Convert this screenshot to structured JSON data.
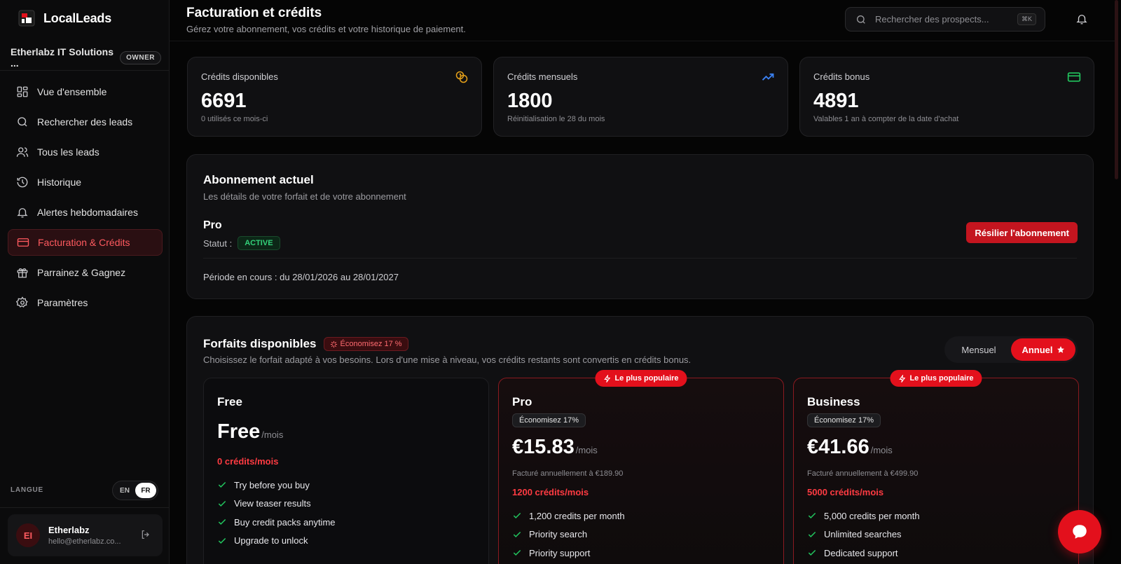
{
  "app": {
    "name": "LocalLeads"
  },
  "org": {
    "name": "Etherlabz IT Solutions ...",
    "role": "OWNER"
  },
  "sidebar": {
    "items": [
      {
        "label": "Vue d'ensemble",
        "icon": "grid-icon"
      },
      {
        "label": "Rechercher des leads",
        "icon": "search-icon"
      },
      {
        "label": "Tous les leads",
        "icon": "users-icon"
      },
      {
        "label": "Historique",
        "icon": "history-icon"
      },
      {
        "label": "Alertes hebdomadaires",
        "icon": "bell-icon"
      },
      {
        "label": "Facturation & Crédits",
        "icon": "credit-card-icon",
        "active": true
      },
      {
        "label": "Parrainez & Gagnez",
        "icon": "gift-icon"
      },
      {
        "label": "Paramètres",
        "icon": "gear-icon"
      }
    ],
    "langue_label": "LANGUE",
    "languages": [
      "EN",
      "FR"
    ],
    "selected_language": "FR"
  },
  "user": {
    "initials": "EI",
    "name": "Etherlabz",
    "email": "hello@etherlabz.co..."
  },
  "header": {
    "title": "Facturation et crédits",
    "subtitle": "Gérez votre abonnement, vos crédits et votre historique de paiement.",
    "search_placeholder": "Rechercher des prospects...",
    "shortcut": "⌘K"
  },
  "stats": [
    {
      "label": "Crédits disponibles",
      "value": "6691",
      "note": "0 utilisés ce mois-ci",
      "icon": "coins-icon",
      "color": "#e5a019"
    },
    {
      "label": "Crédits mensuels",
      "value": "1800",
      "note": "Réinitialisation le 28 du mois",
      "icon": "trending-up-icon",
      "color": "#3b82f6"
    },
    {
      "label": "Crédits bonus",
      "value": "4891",
      "note": "Valables 1 an à compter de la date d'achat",
      "icon": "card-icon",
      "color": "#22c55e"
    }
  ],
  "subscription": {
    "title": "Abonnement actuel",
    "description": "Les détails de votre forfait et de votre abonnement",
    "plan": "Pro",
    "status_label": "Statut :",
    "status": "ACTIVE",
    "cancel_label": "Résilier l'abonnement",
    "period": "Période en cours : du 28/01/2026 au 28/01/2027"
  },
  "plans": {
    "title": "Forfaits disponibles",
    "save_chip": "Économisez 17 %",
    "description": "Choisissez le forfait adapté à vos besoins. Lors d'une mise à niveau, vos crédits restants sont convertis en crédits bonus.",
    "billing_options": [
      "Mensuel",
      "Annuel"
    ],
    "selected_billing": "Annuel",
    "cards": [
      {
        "name": "Free",
        "price": "Free",
        "unit": "/mois",
        "credits": "0 crédits/mois",
        "features": [
          "Try before you buy",
          "View teaser results",
          "Buy credit packs anytime",
          "Upgrade to unlock"
        ]
      },
      {
        "name": "Pro",
        "badge": "Le plus populaire",
        "save": "Économisez 17%",
        "price": "€15.83",
        "unit": "/mois",
        "billed": "Facturé annuellement à €189.90",
        "credits": "1200 crédits/mois",
        "features": [
          "1,200 credits per month",
          "Priority search",
          "Priority support"
        ]
      },
      {
        "name": "Business",
        "badge": "Le plus populaire",
        "save": "Économisez 17%",
        "price": "€41.66",
        "unit": "/mois",
        "billed": "Facturé annuellement à €499.90",
        "credits": "5000 crédits/mois",
        "features": [
          "5,000 credits per month",
          "Unlimited searches",
          "Dedicated support"
        ]
      }
    ]
  },
  "colors": {
    "accent": "#e3101c",
    "success": "#33d17a",
    "background": "#050505"
  }
}
